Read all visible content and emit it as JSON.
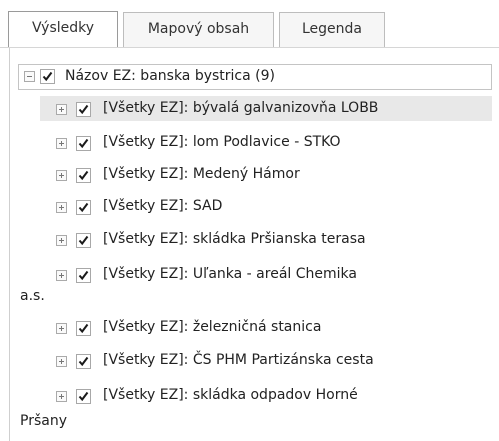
{
  "tabs": [
    {
      "label": "Výsledky"
    },
    {
      "label": "Mapový obsah"
    },
    {
      "label": "Legenda"
    }
  ],
  "tree": {
    "root": {
      "label": "Názov EZ: banska bystrica (9)",
      "checked": true,
      "expanded": true
    },
    "items": [
      {
        "label": "[Všetky EZ]: bývalá galvanizovňa LOBB",
        "checked": true
      },
      {
        "label": "[Všetky EZ]: lom Podlavice - STKO",
        "checked": true
      },
      {
        "label": "[Všetky EZ]: Medený Hámor",
        "checked": true
      },
      {
        "label": "[Všetky EZ]: SAD",
        "checked": true
      },
      {
        "label": "[Všetky EZ]: skládka Pršianska terasa",
        "checked": true
      },
      {
        "label": "[Všetky EZ]: Uľanka - areál Chemika",
        "label_wrap": "a.s.",
        "checked": true
      },
      {
        "label": "[Všetky EZ]: železničná stanica",
        "checked": true
      },
      {
        "label": "[Všetky EZ]: ČS PHM Partizánska cesta",
        "checked": true
      },
      {
        "label": "[Všetky EZ]: skládka odpadov Horné",
        "label_wrap": "Pršany",
        "checked": true
      }
    ]
  },
  "colors": {
    "check": "#1a1a1a",
    "selected_row": "#e8e8e8",
    "border": "#c4c4c4"
  }
}
